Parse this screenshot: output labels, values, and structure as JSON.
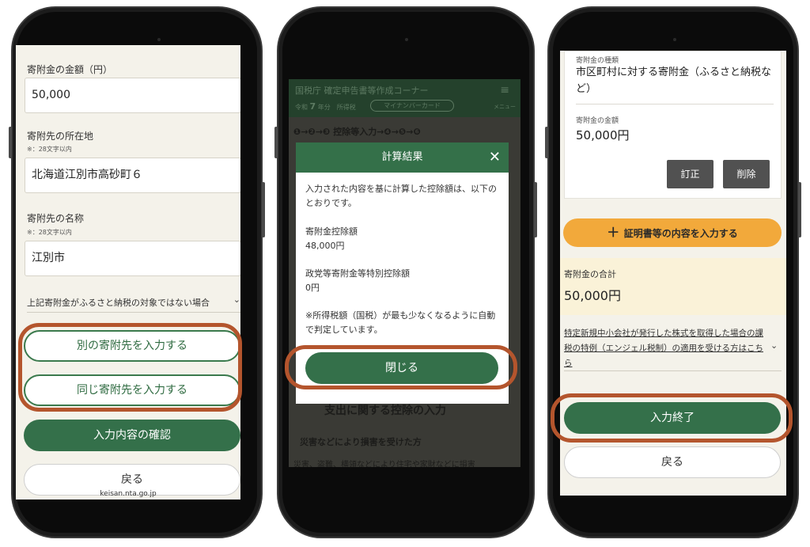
{
  "screen1": {
    "amount_label": "寄附金の金額（円）",
    "amount_value": "50,000",
    "address_label": "寄附先の所在地",
    "address_note": "※：28文字以内",
    "address_value": "北海道江別市高砂町６",
    "name_label": "寄附先の名称",
    "name_note": "※：28文字以内",
    "name_value": "江別市",
    "furusato_link": "上記寄附金がふるさと納税の対象ではない場合",
    "another_donee_button": "別の寄附先を入力する",
    "same_donee_button": "同じ寄附先を入力する",
    "confirm_button": "入力内容の確認",
    "back_button": "戻る",
    "url": "keisan.nta.go.jp"
  },
  "screen2": {
    "site_title": "国税庁 確定申告書等作成コーナー",
    "year_label": "令和",
    "year_num": "7",
    "year_suffix": "年分　所得税",
    "mynumber_badge": "マイナンバーカード",
    "menu_label": "メニュー",
    "steps": "❶→❷→❸ 控除等入力→❹→❺→❻",
    "bg_heading": "支出に関する控除の入力",
    "bg_section": "災害などにより損害を受けた方",
    "bg_text": "災害、盗難、横領などにより住宅や家財などに損害",
    "modal": {
      "title": "計算結果",
      "intro": "入力された内容を基に計算した控除額は、以下のとおりです。",
      "donation_label": "寄附金控除額",
      "donation_value": "48,000円",
      "political_label": "政党等寄附金等特別控除額",
      "political_value": "0円",
      "note": "※所得税額（国税）が最も少なくなるように自動で判定しています。",
      "close_button": "閉じる"
    }
  },
  "screen3": {
    "type_label": "寄附金の種類",
    "type_value": "市区町村に対する寄附金（ふるさと納税など）",
    "amount_label": "寄附金の金額",
    "amount_value": "50,000円",
    "edit_button": "訂正",
    "delete_button": "削除",
    "add_certificate_button": "証明書等の内容を入力する",
    "total_label": "寄附金の合計",
    "total_value": "50,000円",
    "angel_link": "特定新規中小会社が発行した株式を取得した場合の課税の特例（エンジェル税制）の適用を受ける方はこちら",
    "finish_button": "入力終了",
    "back_button": "戻る"
  },
  "colors": {
    "primary_green": "#34704a",
    "highlight_orange": "#b4552d",
    "accent_orange": "#f2a93b",
    "page_bg": "#f4f2ea",
    "total_bg": "#faf2d8"
  }
}
